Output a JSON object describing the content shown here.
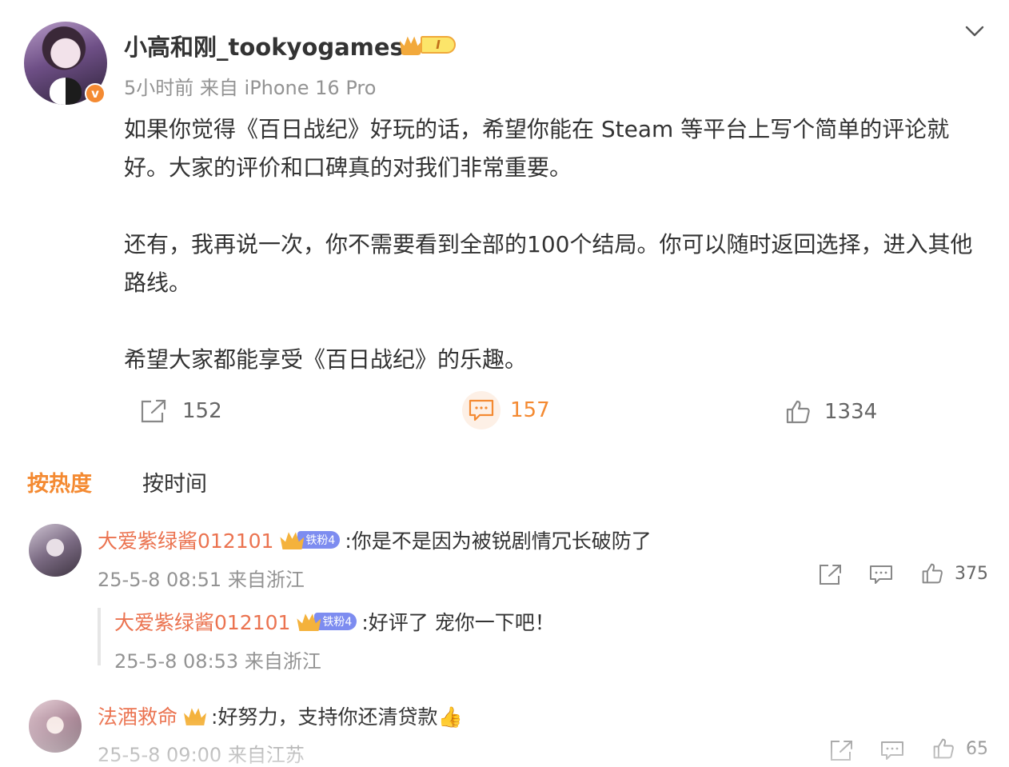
{
  "post": {
    "author": "小高和刚_tookyogames",
    "rank_label": "I",
    "meta": "5小时前  来自 iPhone 16 Pro",
    "paragraphs": [
      "如果你觉得《百日战纪》好玩的话，希望你能在 Steam 等平台上写个简单的评论就好。大家的评价和口碑真的对我们非常重要。",
      "还有，我再说一次，你不需要看到全部的100个结局。你可以随时返回选择，进入其他路线。",
      "希望大家都能享受《百日战纪》的乐趣。"
    ],
    "actions": {
      "repost_count": "152",
      "comment_count": "157",
      "like_count": "1334"
    }
  },
  "sort": {
    "hot_label": "按热度",
    "time_label": "按时间"
  },
  "comments": [
    {
      "name": "大爱紫绿酱012101",
      "fan_badge": "铁粉4",
      "text": ":你是不是因为被锐剧情冗长破防了",
      "time": "25-5-8 08:51 来自浙江",
      "likes": "375",
      "reply": {
        "name": "大爱紫绿酱012101",
        "fan_badge": "铁粉4",
        "text": ":好评了 宠你一下吧！",
        "time": "25-5-8 08:53 来自浙江"
      }
    },
    {
      "name": "法酒救命",
      "text": ":好努力，支持你还清贷款👍",
      "time": "25-5-8 09:00 来自江苏",
      "likes": "65"
    }
  ],
  "colors": {
    "accent": "#f48a32",
    "comment_name": "#eb7350",
    "meta_gray": "#939393",
    "fan_badge": "#7d8cf0"
  },
  "icons": [
    "chevron-down-icon",
    "repost-icon",
    "comment-icon",
    "like-icon",
    "verified-icon",
    "crown-icon"
  ]
}
